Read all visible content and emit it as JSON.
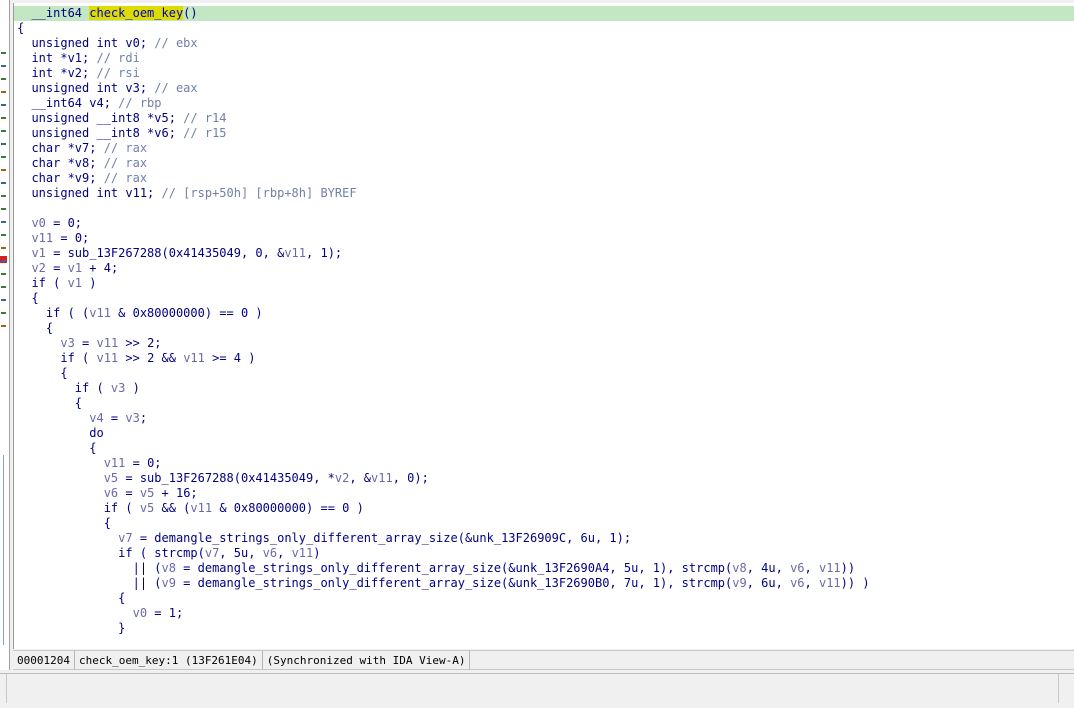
{
  "app": {
    "accent": "#c3e6c3",
    "highlight": "#dcdc00"
  },
  "lines": [
    [
      {
        "t": "  __int64 ",
        "c": "kw"
      },
      {
        "t": "check_oem_key",
        "c": "hlword"
      },
      {
        "t": "()",
        "c": "kw"
      }
    ],
    [
      {
        "t": "{",
        "c": "kw"
      }
    ],
    [
      {
        "t": "  unsigned int v0; ",
        "c": "kw"
      },
      {
        "t": "// ebx",
        "c": "cm"
      }
    ],
    [
      {
        "t": "  int *v1; ",
        "c": "kw"
      },
      {
        "t": "// rdi",
        "c": "cm"
      }
    ],
    [
      {
        "t": "  int *v2; ",
        "c": "kw"
      },
      {
        "t": "// rsi",
        "c": "cm"
      }
    ],
    [
      {
        "t": "  unsigned int v3; ",
        "c": "kw"
      },
      {
        "t": "// eax",
        "c": "cm"
      }
    ],
    [
      {
        "t": "  __int64 v4; ",
        "c": "kw"
      },
      {
        "t": "// rbp",
        "c": "cm"
      }
    ],
    [
      {
        "t": "  unsigned __int8 *v5; ",
        "c": "kw"
      },
      {
        "t": "// r14",
        "c": "cm"
      }
    ],
    [
      {
        "t": "  unsigned __int8 *v6; ",
        "c": "kw"
      },
      {
        "t": "// r15",
        "c": "cm"
      }
    ],
    [
      {
        "t": "  char *v7; ",
        "c": "kw"
      },
      {
        "t": "// rax",
        "c": "cm"
      }
    ],
    [
      {
        "t": "  char *v8; ",
        "c": "kw"
      },
      {
        "t": "// rax",
        "c": "cm"
      }
    ],
    [
      {
        "t": "  char *v9; ",
        "c": "kw"
      },
      {
        "t": "// rax",
        "c": "cm"
      }
    ],
    [
      {
        "t": "  unsigned int v11; ",
        "c": "kw"
      },
      {
        "t": "// [rsp+50h] [rbp+8h] BYREF",
        "c": "cm"
      }
    ],
    [
      {
        "t": "",
        "c": "kw"
      }
    ],
    [
      {
        "t": "  ",
        "c": "kw"
      },
      {
        "t": "v0",
        "c": "vr"
      },
      {
        "t": " = 0;",
        "c": "kw"
      }
    ],
    [
      {
        "t": "  ",
        "c": "kw"
      },
      {
        "t": "v11",
        "c": "vr"
      },
      {
        "t": " = 0;",
        "c": "kw"
      }
    ],
    [
      {
        "t": "  ",
        "c": "kw"
      },
      {
        "t": "v1",
        "c": "vr"
      },
      {
        "t": " = sub_13F267288(0x41435049, 0, &",
        "c": "kw"
      },
      {
        "t": "v11",
        "c": "vr"
      },
      {
        "t": ", 1);",
        "c": "kw"
      }
    ],
    [
      {
        "t": "  ",
        "c": "kw"
      },
      {
        "t": "v2",
        "c": "vr"
      },
      {
        "t": " = ",
        "c": "kw"
      },
      {
        "t": "v1",
        "c": "vr"
      },
      {
        "t": " + 4;",
        "c": "kw"
      }
    ],
    [
      {
        "t": "  if ( ",
        "c": "kw"
      },
      {
        "t": "v1",
        "c": "vr"
      },
      {
        "t": " )",
        "c": "kw"
      }
    ],
    [
      {
        "t": "  {",
        "c": "kw"
      }
    ],
    [
      {
        "t": "    if ( (",
        "c": "kw"
      },
      {
        "t": "v11",
        "c": "vr"
      },
      {
        "t": " & 0x80000000) == 0 )",
        "c": "kw"
      }
    ],
    [
      {
        "t": "    {",
        "c": "kw"
      }
    ],
    [
      {
        "t": "      ",
        "c": "kw"
      },
      {
        "t": "v3",
        "c": "vr"
      },
      {
        "t": " = ",
        "c": "kw"
      },
      {
        "t": "v11",
        "c": "vr"
      },
      {
        "t": " >> 2;",
        "c": "kw"
      }
    ],
    [
      {
        "t": "      if ( ",
        "c": "kw"
      },
      {
        "t": "v11",
        "c": "vr"
      },
      {
        "t": " >> 2 && ",
        "c": "kw"
      },
      {
        "t": "v11",
        "c": "vr"
      },
      {
        "t": " >= 4 )",
        "c": "kw"
      }
    ],
    [
      {
        "t": "      {",
        "c": "kw"
      }
    ],
    [
      {
        "t": "        if ( ",
        "c": "kw"
      },
      {
        "t": "v3",
        "c": "vr"
      },
      {
        "t": " )",
        "c": "kw"
      }
    ],
    [
      {
        "t": "        {",
        "c": "kw"
      }
    ],
    [
      {
        "t": "          ",
        "c": "kw"
      },
      {
        "t": "v4",
        "c": "vr"
      },
      {
        "t": " = ",
        "c": "kw"
      },
      {
        "t": "v3",
        "c": "vr"
      },
      {
        "t": ";",
        "c": "kw"
      }
    ],
    [
      {
        "t": "          do",
        "c": "kw"
      }
    ],
    [
      {
        "t": "          {",
        "c": "kw"
      }
    ],
    [
      {
        "t": "            ",
        "c": "kw"
      },
      {
        "t": "v11",
        "c": "vr"
      },
      {
        "t": " = 0;",
        "c": "kw"
      }
    ],
    [
      {
        "t": "            ",
        "c": "kw"
      },
      {
        "t": "v5",
        "c": "vr"
      },
      {
        "t": " = sub_13F267288(0x41435049, *",
        "c": "kw"
      },
      {
        "t": "v2",
        "c": "vr"
      },
      {
        "t": ", &",
        "c": "kw"
      },
      {
        "t": "v11",
        "c": "vr"
      },
      {
        "t": ", 0);",
        "c": "kw"
      }
    ],
    [
      {
        "t": "            ",
        "c": "kw"
      },
      {
        "t": "v6",
        "c": "vr"
      },
      {
        "t": " = ",
        "c": "kw"
      },
      {
        "t": "v5",
        "c": "vr"
      },
      {
        "t": " + 16;",
        "c": "kw"
      }
    ],
    [
      {
        "t": "            if ( ",
        "c": "kw"
      },
      {
        "t": "v5",
        "c": "vr"
      },
      {
        "t": " && (",
        "c": "kw"
      },
      {
        "t": "v11",
        "c": "vr"
      },
      {
        "t": " & 0x80000000) == 0 )",
        "c": "kw"
      }
    ],
    [
      {
        "t": "            {",
        "c": "kw"
      }
    ],
    [
      {
        "t": "              ",
        "c": "kw"
      },
      {
        "t": "v7",
        "c": "vr"
      },
      {
        "t": " = demangle_strings_only_different_array_size(&unk_13F26909C, 6u, 1);",
        "c": "kw"
      }
    ],
    [
      {
        "t": "              if ( strcmp(",
        "c": "kw"
      },
      {
        "t": "v7",
        "c": "vr"
      },
      {
        "t": ", 5u, ",
        "c": "kw"
      },
      {
        "t": "v6",
        "c": "vr"
      },
      {
        "t": ", ",
        "c": "kw"
      },
      {
        "t": "v11",
        "c": "vr"
      },
      {
        "t": ")",
        "c": "kw"
      }
    ],
    [
      {
        "t": "                || (",
        "c": "kw"
      },
      {
        "t": "v8",
        "c": "vr"
      },
      {
        "t": " = demangle_strings_only_different_array_size(&unk_13F2690A4, 5u, 1), strcmp(",
        "c": "kw"
      },
      {
        "t": "v8",
        "c": "vr"
      },
      {
        "t": ", 4u, ",
        "c": "kw"
      },
      {
        "t": "v6",
        "c": "vr"
      },
      {
        "t": ", ",
        "c": "kw"
      },
      {
        "t": "v11",
        "c": "vr"
      },
      {
        "t": "))",
        "c": "kw"
      }
    ],
    [
      {
        "t": "                || (",
        "c": "kw"
      },
      {
        "t": "v9",
        "c": "vr"
      },
      {
        "t": " = demangle_strings_only_different_array_size(&unk_13F2690B0, 7u, 1), strcmp(",
        "c": "kw"
      },
      {
        "t": "v9",
        "c": "vr"
      },
      {
        "t": ", 6u, ",
        "c": "kw"
      },
      {
        "t": "v6",
        "c": "vr"
      },
      {
        "t": ", ",
        "c": "kw"
      },
      {
        "t": "v11",
        "c": "vr"
      },
      {
        "t": ")) )",
        "c": "kw"
      }
    ],
    [
      {
        "t": "              {",
        "c": "kw"
      }
    ],
    [
      {
        "t": "                ",
        "c": "kw"
      },
      {
        "t": "v0",
        "c": "vr"
      },
      {
        "t": " = 1;",
        "c": "kw"
      }
    ],
    [
      {
        "t": "              }",
        "c": "kw"
      }
    ]
  ],
  "status": {
    "address": "00001204",
    "location": "check_oem_key:1 (13F261E04)",
    "sync": "(Synchronized with IDA View-A)"
  }
}
